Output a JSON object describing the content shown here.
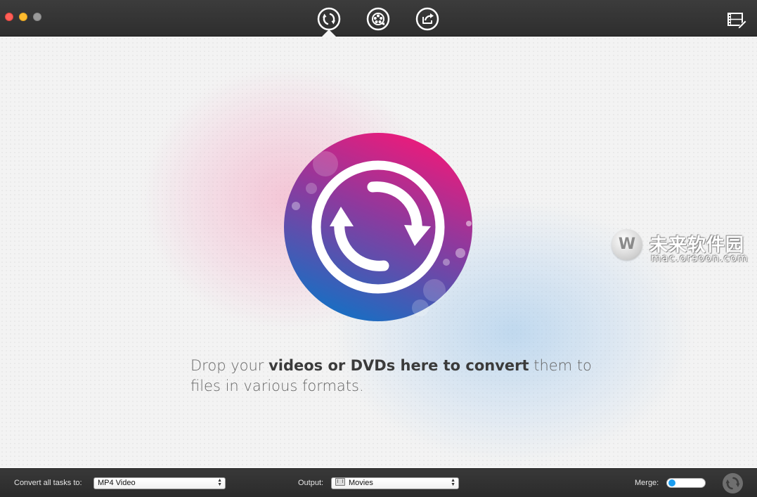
{
  "toolbar": {
    "buttons": [
      {
        "name": "convert-tab",
        "icon": "convert-arrows-icon",
        "active": true
      },
      {
        "name": "burn-tab",
        "icon": "film-reel-icon",
        "active": false
      },
      {
        "name": "share-tab",
        "icon": "share-icon",
        "active": false
      }
    ],
    "right_icon": "film-edit-icon"
  },
  "main": {
    "drop_text_pre": "Drop your ",
    "drop_text_bold": "videos or DVDs here to convert",
    "drop_text_post": " them to files in various formats.",
    "logo_icon": "convert-circle-icon"
  },
  "watermark": {
    "title": "未来软件园",
    "url": "mac.orsoon.com",
    "logo_letter": "W"
  },
  "bottom_bar": {
    "convert_label": "Convert all tasks to:",
    "convert_value": "MP4 Video",
    "output_label": "Output:",
    "output_value": "Movies",
    "merge_label": "Merge:",
    "merge_on": false
  },
  "colors": {
    "accent": "#1a9df0",
    "logo_top": "#e91e7a",
    "logo_mid": "#8a3aa0",
    "logo_bottom": "#1a6fc0"
  }
}
